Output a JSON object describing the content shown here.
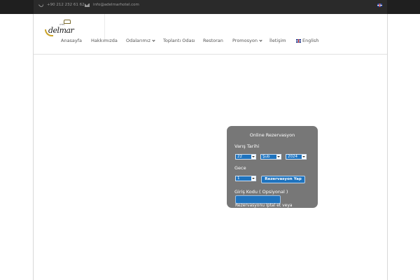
{
  "topbar": {
    "phone": "+90 212 232 61 62",
    "email": "info@adelmarhotel.com",
    "phone_icon": "phone-icon",
    "email_icon": "mail-icon",
    "lang_flag_icon": "uk-flag-icon"
  },
  "logo": {
    "text": "delmar",
    "subtext": "OTEL"
  },
  "nav": {
    "items": [
      {
        "label": "Anasayfa",
        "dropdown": false
      },
      {
        "label": "Hakkımızda",
        "dropdown": false
      },
      {
        "label": "Odalarımız",
        "dropdown": true
      },
      {
        "label": "Toplantı Odası",
        "dropdown": false
      },
      {
        "label": "Restoran",
        "dropdown": false
      },
      {
        "label": "Promosyon",
        "dropdown": true
      },
      {
        "label": "İletişim",
        "dropdown": false
      },
      {
        "label": "English",
        "dropdown": false
      }
    ]
  },
  "reservation": {
    "title": "Online Rezervasyon",
    "arrival_label": "Varış Tarihi",
    "day": "22",
    "month": "Şub",
    "year": "2024",
    "nights_label": "Gece",
    "nights": "1",
    "submit_label": "Rezervasyon Yap",
    "code_label": "Giriş Kodu ( Opsiyonal )",
    "code_value": "",
    "cut_text": "Rezervasyonu Iptal et veya"
  },
  "colors": {
    "topbar_bg": "#2a2a2a",
    "widget_bg": "#777777",
    "accent": "#1e73be"
  }
}
